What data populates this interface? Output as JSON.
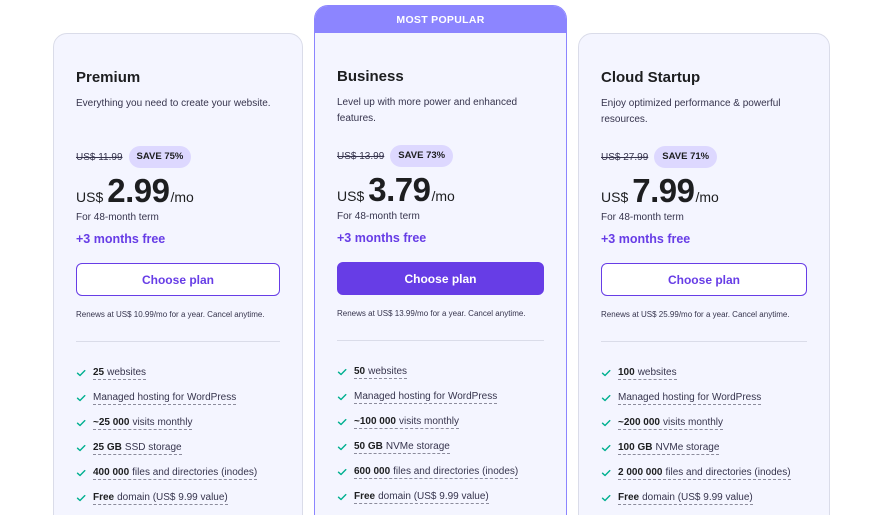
{
  "plans": [
    {
      "name": "Premium",
      "description": "Everything you need to create your website.",
      "old_price": "US$ 11.99",
      "save": "SAVE 75%",
      "currency": "US$",
      "amount": "2.99",
      "per": "/mo",
      "term": "For 48-month term",
      "free": "+3 months free",
      "button": "Choose plan",
      "renew": "Renews at US$ 10.99/mo for a year. Cancel anytime.",
      "features": [
        {
          "bold": "25",
          "text": "websites"
        },
        {
          "bold": "",
          "text": "Managed hosting for WordPress"
        },
        {
          "bold": "~25 000",
          "text": "visits monthly"
        },
        {
          "bold": "25 GB",
          "text": "SSD storage"
        },
        {
          "bold": "400 000",
          "text": "files and directories (inodes)"
        },
        {
          "bold": "Free",
          "text": "domain (US$ 9.99 value)"
        }
      ]
    },
    {
      "badge": "MOST POPULAR",
      "name": "Business",
      "description": "Level up with more power and enhanced features.",
      "old_price": "US$ 13.99",
      "save": "SAVE 73%",
      "currency": "US$",
      "amount": "3.79",
      "per": "/mo",
      "term": "For 48-month term",
      "free": "+3 months free",
      "button": "Choose plan",
      "renew": "Renews at US$ 13.99/mo for a year. Cancel anytime.",
      "features": [
        {
          "bold": "50",
          "text": "websites"
        },
        {
          "bold": "",
          "text": "Managed hosting for WordPress"
        },
        {
          "bold": "~100 000",
          "text": "visits monthly"
        },
        {
          "bold": "50 GB",
          "text": "NVMe storage"
        },
        {
          "bold": "600 000",
          "text": "files and directories (inodes)"
        },
        {
          "bold": "Free",
          "text": "domain (US$ 9.99 value)"
        }
      ]
    },
    {
      "name": "Cloud Startup",
      "description": "Enjoy optimized performance & powerful resources.",
      "old_price": "US$ 27.99",
      "save": "SAVE 71%",
      "currency": "US$",
      "amount": "7.99",
      "per": "/mo",
      "term": "For 48-month term",
      "free": "+3 months free",
      "button": "Choose plan",
      "renew": "Renews at US$ 25.99/mo for a year. Cancel anytime.",
      "features": [
        {
          "bold": "100",
          "text": "websites"
        },
        {
          "bold": "",
          "text": "Managed hosting for WordPress"
        },
        {
          "bold": "~200 000",
          "text": "visits monthly"
        },
        {
          "bold": "100 GB",
          "text": "NVMe storage"
        },
        {
          "bold": "2 000 000",
          "text": "files and directories (inodes)"
        },
        {
          "bold": "Free",
          "text": "domain (US$ 9.99 value)"
        }
      ]
    }
  ],
  "colors": {
    "accent": "#673de6",
    "badge_bg": "#8c85ff",
    "save_bg": "#ddd8ff",
    "card_bg": "#f4f5ff",
    "check": "#00b090"
  },
  "icons": {
    "feature": "check-icon"
  }
}
